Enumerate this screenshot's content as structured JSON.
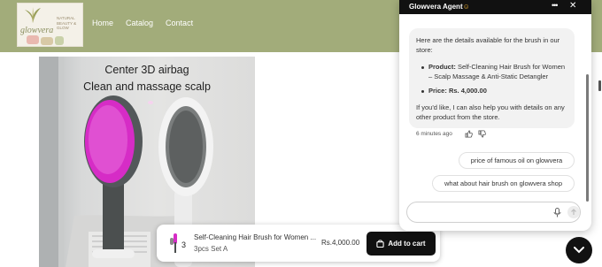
{
  "header": {
    "logo": {
      "wordmark": "glowvera",
      "tagline": "NATURAL BEAUTY & GLOW"
    },
    "nav": [
      {
        "label": "Home"
      },
      {
        "label": "Catalog"
      },
      {
        "label": "Contact"
      }
    ]
  },
  "product_image": {
    "caption_line1": "Center 3D airbag",
    "caption_line2": "Clean and massage scalp"
  },
  "cart_bar": {
    "product_title": "Self-Cleaning Hair Brush for Women ...",
    "variant": "3pcs Set A",
    "price": "Rs.4,000.00",
    "button_label": "Add to cart",
    "thumb_badge": "3"
  },
  "chat": {
    "title": "Glowvera Agent",
    "title_emoji": "☺",
    "more_icon": "more-dots-icon",
    "close_icon": "close-icon",
    "agent_message": {
      "intro": "Here are the details available for the brush in our store:",
      "product_label": "Product:",
      "product_value": "Self-Cleaning Hair Brush for Women – Scalp Massage & Anti-Static Detangler",
      "price_label": "Price:",
      "price_value": "Rs. 4,000.00",
      "outro": "If you'd like, I can also help you with details on any other product from the store.",
      "timestamp": "6 minutes ago"
    },
    "user_messages": [
      "price of famous oil on glowvera",
      "what about hair brush on glowvera shop"
    ],
    "input": {
      "value": "",
      "placeholder": ""
    }
  },
  "colors": {
    "header_bg": "#a2ac7a",
    "brush_pink": "#d62cc6",
    "dark": "#111111"
  }
}
